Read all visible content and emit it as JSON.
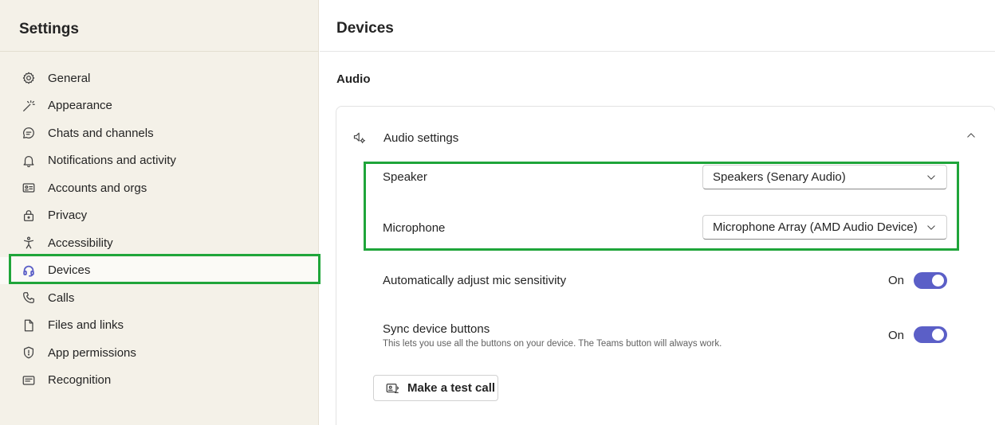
{
  "sidebar": {
    "title": "Settings",
    "items": [
      {
        "label": "General",
        "icon": "gear-icon"
      },
      {
        "label": "Appearance",
        "icon": "magic-wand-icon"
      },
      {
        "label": "Chats and channels",
        "icon": "chat-icon"
      },
      {
        "label": "Notifications and activity",
        "icon": "bell-icon"
      },
      {
        "label": "Accounts and orgs",
        "icon": "contact-card-icon"
      },
      {
        "label": "Privacy",
        "icon": "lock-icon"
      },
      {
        "label": "Accessibility",
        "icon": "accessibility-icon"
      },
      {
        "label": "Devices",
        "icon": "headset-icon",
        "active": true
      },
      {
        "label": "Calls",
        "icon": "phone-icon"
      },
      {
        "label": "Files and links",
        "icon": "document-icon"
      },
      {
        "label": "App permissions",
        "icon": "shield-icon"
      },
      {
        "label": "Recognition",
        "icon": "id-card-icon"
      }
    ]
  },
  "main": {
    "title": "Devices",
    "section": "Audio",
    "audio_settings": {
      "header": "Audio settings",
      "speaker_label": "Speaker",
      "speaker_value": "Speakers (Senary Audio)",
      "microphone_label": "Microphone",
      "microphone_value": "Microphone Array (AMD Audio Device)",
      "auto_adjust_label": "Automatically adjust mic sensitivity",
      "auto_adjust_state": "On",
      "sync_label": "Sync device buttons",
      "sync_desc": "This lets you use all the buttons on your device. The Teams button will always work.",
      "sync_state": "On",
      "test_call_label": "Make a test call"
    }
  },
  "colors": {
    "accent": "#5b5fc7",
    "highlight": "#1fa53a",
    "sidebar_bg": "#f4f1e8"
  }
}
